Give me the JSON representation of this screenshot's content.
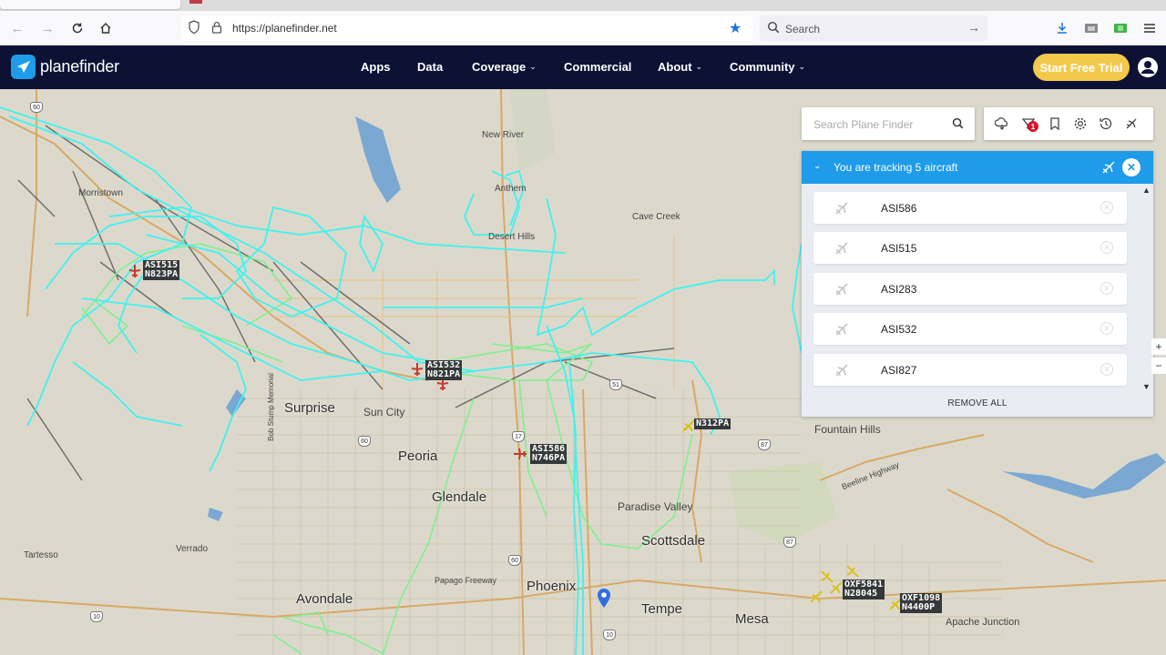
{
  "browser": {
    "url": "https://planefinder.net",
    "search_placeholder": "Search"
  },
  "nav": {
    "brand": "planefinder",
    "items": [
      "Apps",
      "Data",
      "Coverage",
      "Commercial",
      "About",
      "Community"
    ],
    "cta": "Start Free Trial"
  },
  "map": {
    "towns": [
      {
        "name": "Morristown"
      },
      {
        "name": "New River"
      },
      {
        "name": "Anthem"
      },
      {
        "name": "Cave Creek"
      },
      {
        "name": "Desert Hills"
      },
      {
        "name": "Sun City"
      },
      {
        "name": "Paradise Valley"
      },
      {
        "name": "Fountain Hills"
      },
      {
        "name": "Tartesso"
      },
      {
        "name": "Verrado"
      },
      {
        "name": "Apache Junction"
      },
      {
        "name": "Papago Freeway"
      },
      {
        "name": "Beeline Highway"
      },
      {
        "name": "Bob Stump Memorial"
      }
    ],
    "cities": [
      "Surprise",
      "Peoria",
      "Glendale",
      "Scottsdale",
      "Avondale",
      "Phoenix",
      "Tempe",
      "Mesa"
    ],
    "highway_shields": [
      "60",
      "60",
      "17",
      "51",
      "87",
      "87",
      "60",
      "10",
      "10"
    ],
    "flights": [
      {
        "callsign": "ASI515",
        "reg": "N823PA"
      },
      {
        "callsign": "ASI532",
        "reg": "N821PA"
      },
      {
        "callsign": "ASI586",
        "reg": "N746PA"
      },
      {
        "callsign": "N312PA",
        "reg": ""
      },
      {
        "callsign": "OXF5841",
        "reg": "N28045"
      },
      {
        "callsign": "OXF1098",
        "reg": "N4400P"
      }
    ]
  },
  "search": {
    "placeholder": "Search Plane Finder"
  },
  "toolbar": {
    "filter_badge": "1"
  },
  "tracking": {
    "title": "You are tracking 5 aircraft",
    "aircraft": [
      "ASI586",
      "ASI515",
      "ASI283",
      "ASI532",
      "ASI827"
    ],
    "remove_all": "REMOVE ALL"
  },
  "zoom": {
    "in": "+",
    "out": "−"
  }
}
